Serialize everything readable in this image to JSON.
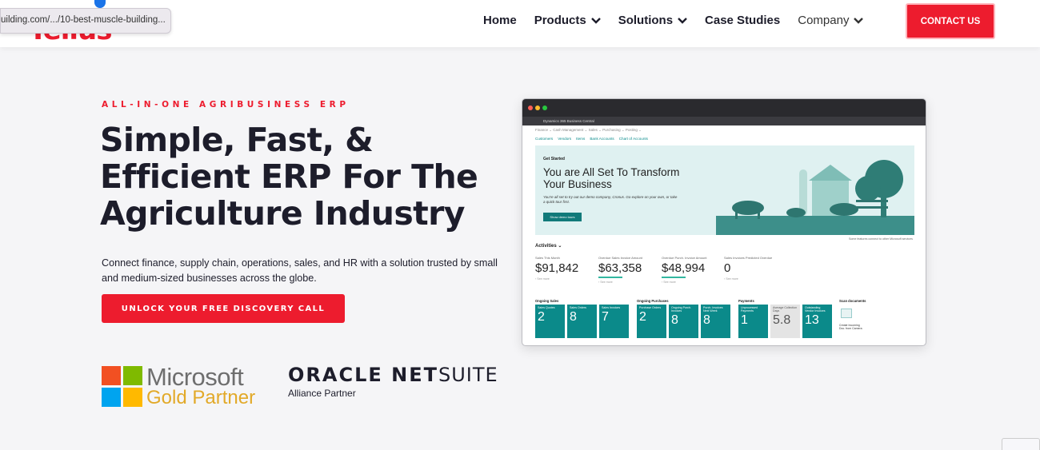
{
  "browser": {
    "hover_url": "uilding.com/.../10-best-muscle-building..."
  },
  "header": {
    "logo": "Tellus",
    "nav": [
      {
        "label": "Home",
        "dropdown": false
      },
      {
        "label": "Products",
        "dropdown": true
      },
      {
        "label": "Solutions",
        "dropdown": true
      },
      {
        "label": "Case Studies",
        "dropdown": false
      },
      {
        "label": "Company",
        "dropdown": true
      }
    ],
    "contact_label": "CONTACT US"
  },
  "hero": {
    "eyebrow": "ALL-IN-ONE AGRIBUSINESS ERP",
    "headline": "Simple, Fast, & Efficient ERP For The Agriculture Industry",
    "subtext": "Connect finance, supply chain, operations, sales, and HR with a solution trusted by small and medium-sized businesses across the globe.",
    "cta_label": "UNLOCK YOUR FREE DISCOVERY CALL"
  },
  "partners": {
    "microsoft_line1": "Microsoft",
    "microsoft_line2": "Gold Partner",
    "oracle_bold": "ORACLE NET",
    "oracle_light": "SUITE",
    "oracle_sub": "Alliance Partner"
  },
  "screenshot": {
    "app_bar": "Dynamics 365 Business Central",
    "menu": "Finance ⌄   Cash Management ⌄   Sales ⌄   Purchasing ⌄   Posting ⌄",
    "links": [
      "Customers",
      "Vendors",
      "Items",
      "Bank Accounts",
      "Chart of Accounts"
    ],
    "banner_label": "Get Started",
    "banner_title": "You are All Set To Transform Your Business",
    "banner_text": "You're all set to try out our demo company, Cronus. Go explore on your own, or take a quick tour first.",
    "banner_button": "Show demo tours",
    "banner_note": "Some features connect to other Microsoft services",
    "activities_label": "Activities ⌄",
    "kpis": [
      {
        "label": "Sales This Month",
        "value": "$91,842",
        "sub": "› See more"
      },
      {
        "label": "Overdue Sales Invoice Amount",
        "value": "$63,358",
        "sub": "› See more"
      },
      {
        "label": "Overdue Purch. Invoice Amount",
        "value": "$48,994",
        "sub": "› See more"
      },
      {
        "label": "Sales Invoices Predicted Overdue",
        "value": "0",
        "sub": "› See more"
      }
    ],
    "tile_groups": [
      "Ongoing Sales",
      "Ongoing Purchases",
      "Payments",
      "Scan documents"
    ],
    "tiles": [
      {
        "label": "Sales Quotes",
        "value": "2"
      },
      {
        "label": "Sales Orders",
        "value": "8"
      },
      {
        "label": "Sales Invoices",
        "value": "7"
      },
      {
        "label": "Purchase Orders",
        "value": "2"
      },
      {
        "label": "Ongoing Purch. Invoices",
        "value": "8"
      },
      {
        "label": "Purch. Invoices Next Week",
        "value": "8"
      },
      {
        "label": "Unprocessed Payments",
        "value": "1"
      },
      {
        "label": "Average Collection Days",
        "value": "5.8"
      },
      {
        "label": "Outstanding Vendor Invoices",
        "value": "13"
      }
    ],
    "scan_label": "Create Incoming Doc. from Camera"
  },
  "colors": {
    "brand": "#ed1c2e",
    "teal": "#0b8a8a",
    "text": "#1d1d2b"
  }
}
